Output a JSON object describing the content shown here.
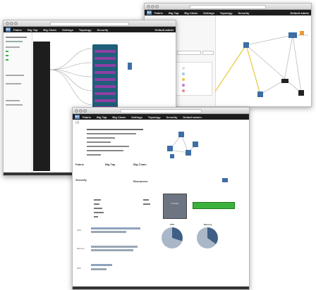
{
  "nav": {
    "logo": "BX",
    "menu": [
      "Fabric",
      "Big Tap",
      "Big Chain",
      "Settings",
      "Topology",
      "Security"
    ],
    "user": "Default admin"
  },
  "back_right": {
    "menu": [
      "Fabric",
      "Big Tap",
      "Big Chain",
      "Settings",
      "Topology",
      "Security"
    ],
    "user": "Default admin"
  },
  "back_left": {
    "menu": [
      "Fabric",
      "Big Tap",
      "Big Chain",
      "Settings",
      "Topology",
      "Security"
    ],
    "user": "Default admin"
  },
  "front": {
    "title": "IX",
    "sections": {
      "fabric": "Fabric",
      "big_tap": "Big Tap",
      "big_chain": "Big Chain",
      "security": "Security",
      "resources": "Resources"
    },
    "cpu_label": "CPU",
    "memory_label": "Memory",
    "row_labels": [
      "CPU",
      "Memory",
      "Disk"
    ],
    "controller_label": "Controller"
  },
  "colors": {
    "nav_bg": "#1d1d1d",
    "accent_blue": "#4c82b8",
    "flow_teal": "#1f5f79",
    "flow_purple": "#8e3fa3",
    "link_green": "#3cb23c",
    "switch_blue": "#3d6ea5"
  }
}
